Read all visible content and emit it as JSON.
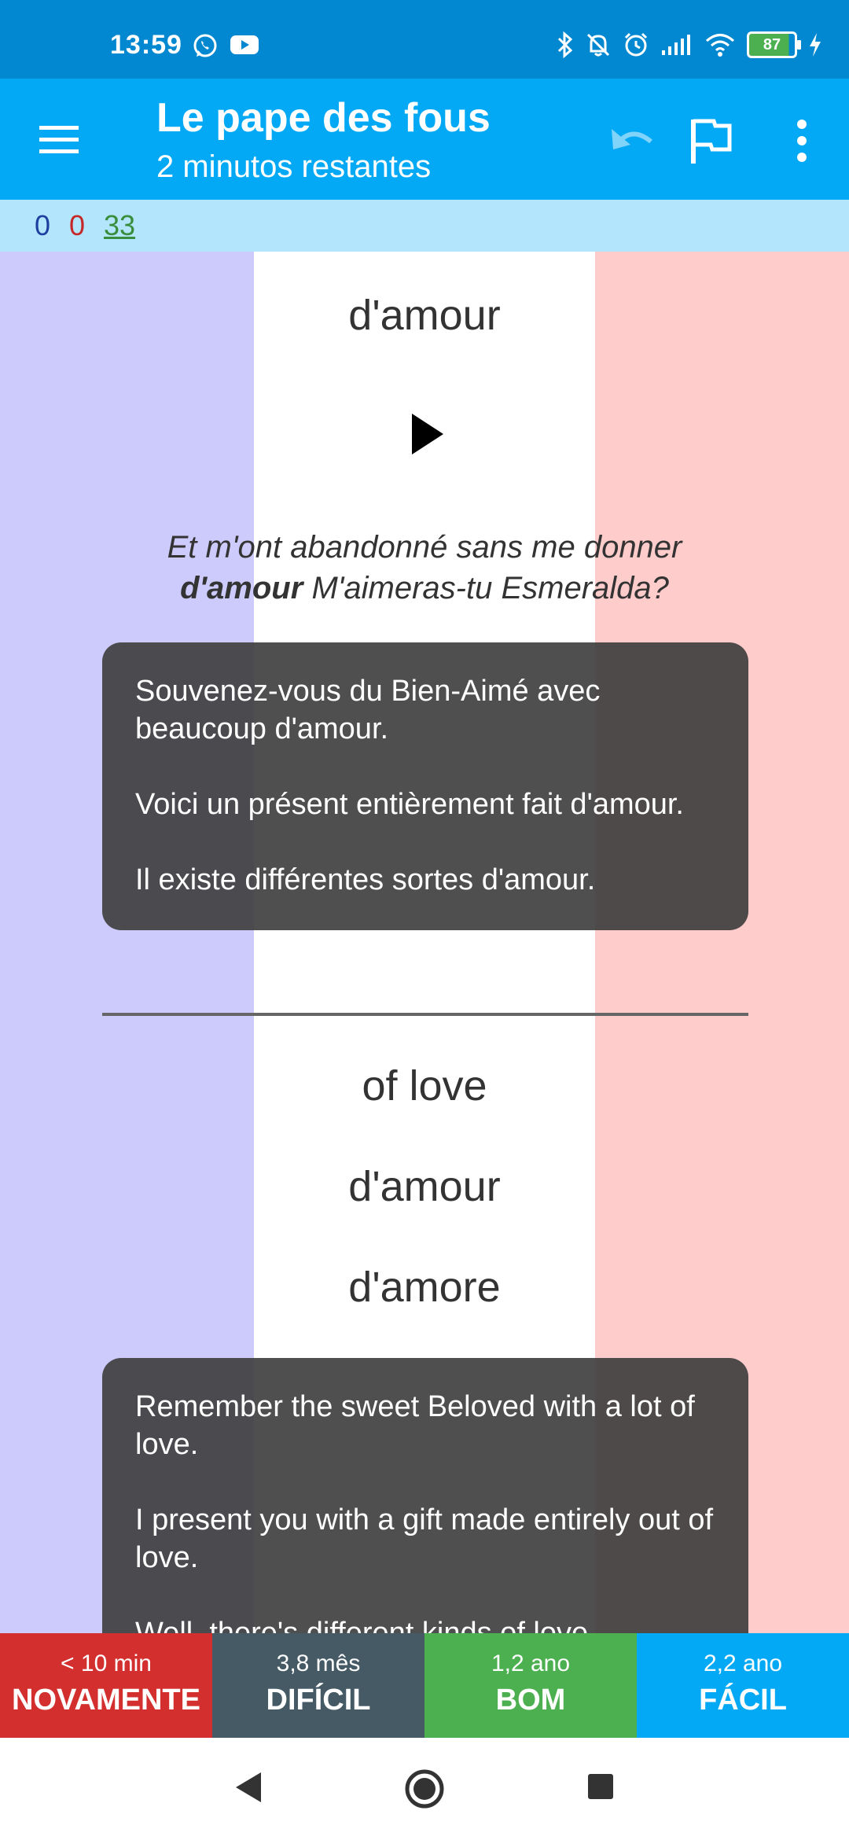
{
  "status_bar": {
    "time": "13:59",
    "app_icons": [
      "whatsapp-icon",
      "youtube-icon"
    ],
    "system_icons": [
      "bluetooth-icon",
      "bell-off-icon",
      "alarm-icon",
      "signal-icon",
      "wifi-icon",
      "battery-icon"
    ],
    "battery": "87"
  },
  "app_bar": {
    "title": "Le pape des fous",
    "subtitle": "2 minutos restantes",
    "icons": [
      "menu-icon",
      "undo-icon",
      "flag-icon",
      "more-vert-icon"
    ]
  },
  "counts": {
    "new": "0",
    "learning": "0",
    "review": "33"
  },
  "card": {
    "front_word": "d'amour",
    "sentence_before": "Et m'ont abandonné sans me donner",
    "sentence_bold": "d'amour",
    "sentence_after": "M'aimeras-tu Esmeralda?",
    "examples_fr": [
      "Souvenez-vous du Bien-Aimé avec beaucoup d'amour.",
      "Voici un présent entièrement fait d'amour.",
      "Il existe différentes sortes d'amour."
    ],
    "translations": [
      "of love",
      "d'amour",
      "d'amore"
    ],
    "examples_en": [
      "Remember the sweet Beloved with a lot of love.",
      "I present you with a gift made entirely out of love.",
      "Well, there's different kinds of love."
    ]
  },
  "answer_buttons": [
    {
      "interval": "< 10 min",
      "label": "NOVAMENTE"
    },
    {
      "interval": "3,8 mês",
      "label": "DIFÍCIL"
    },
    {
      "interval": "1,2 ano",
      "label": "BOM"
    },
    {
      "interval": "2,2 ano",
      "label": "FÁCIL"
    }
  ],
  "colors": {
    "status_bar": "#0288D1",
    "app_bar": "#03A9F4",
    "counts_bar": "#B3E5FC",
    "flag_blue": "#CDCBFB",
    "flag_white": "#FFFFFF",
    "flag_red": "#FFCCCC",
    "again": "#D32F2F",
    "hard": "#455A64",
    "good": "#4CAF50",
    "easy": "#03A9F4"
  }
}
